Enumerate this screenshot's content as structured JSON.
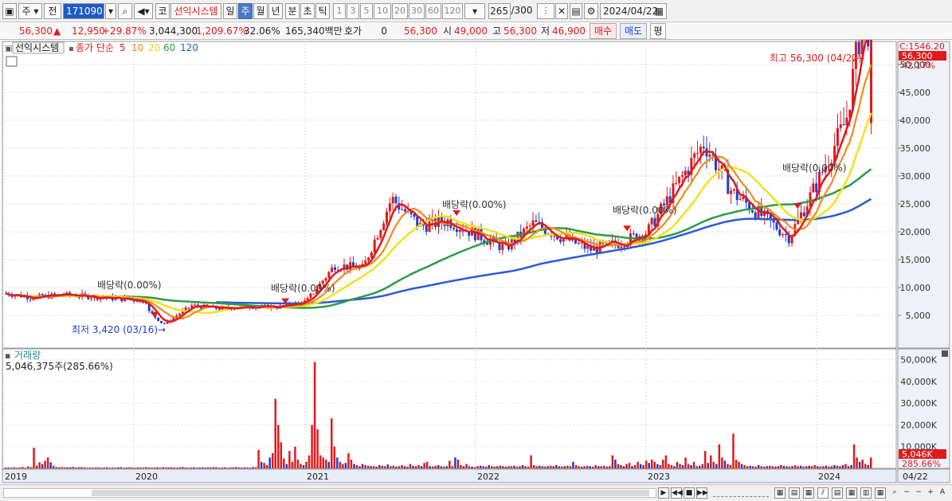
{
  "toolbar": {
    "market": "주",
    "kind": "전",
    "code": "171090",
    "name_prefix": "코",
    "name": "선익시스템",
    "periods": [
      "일",
      "주",
      "월",
      "년",
      "분",
      "초",
      "틱"
    ],
    "active_period": "주",
    "nums": [
      "1",
      "3",
      "5",
      "10",
      "20",
      "30",
      "60",
      "120"
    ],
    "count": "265",
    "count_total": "/300",
    "date": "2024/04/22"
  },
  "quote": {
    "price": "56,300",
    "change": "12,950",
    "change_pct": "+29.87%",
    "volume": "3,044,300",
    "vol_pct": "1,209.67%",
    "turnover": "32.06%",
    "amount": "165,340백만",
    "hoga_label": "호가",
    "hoga_val": "0",
    "ask": "56,300",
    "open_label": "시",
    "open": "49,000",
    "high_label": "고",
    "high": "56,300",
    "low_label": "저",
    "low": "46,900",
    "buy": "매수",
    "sell": "매도",
    "eval": "평"
  },
  "legend": {
    "name": "선익시스템",
    "ma_prefix": "종가 단순",
    "ma5": "5",
    "ma10": "10",
    "ma20": "20",
    "ma60": "60",
    "ma120": "120",
    "colors": {
      "ma5": "#e01a1a",
      "ma10": "#f08a1a",
      "ma20": "#f2e21a",
      "ma60": "#2e9a4a",
      "ma120": "#2a5ad6"
    }
  },
  "annotations": {
    "c_label": "C:1546.20",
    "last_price": "56,300",
    "last_pct": "42.17%",
    "high_note": "최고 56,300 (04/22)",
    "low_note": "최저 3,420 (03/16)",
    "dividend": "배당락(0.00%)"
  },
  "volume_pane": {
    "title": "거래량",
    "value": "5,046,375주(285.66%)",
    "last_tag": "5,046K",
    "last_pct": "285.66%"
  },
  "chart_data": {
    "type": "candlestick",
    "price_axis": [
      "50,000",
      "45,000",
      "40,000",
      "35,000",
      "30,000",
      "25,000",
      "20,000",
      "15,000",
      "10,000",
      "5,000"
    ],
    "price_ylim": [
      0,
      55000
    ],
    "volume_axis": [
      "50,000K",
      "40,000K",
      "30,000K",
      "20,000K",
      "10,000K"
    ],
    "x_labels": [
      "2019",
      "2020",
      "2021",
      "2022",
      "2023",
      "2024",
      "04/22"
    ],
    "close_series": [
      [
        "2019-01",
        9000
      ],
      [
        "2019-03",
        8200
      ],
      [
        "2019-05",
        8700
      ],
      [
        "2019-07",
        8400
      ],
      [
        "2019-09",
        8000
      ],
      [
        "2019-11",
        7600
      ],
      [
        "2020-01",
        7800
      ],
      [
        "2020-03",
        3420
      ],
      [
        "2020-05",
        6800
      ],
      [
        "2020-07",
        6200
      ],
      [
        "2020-09",
        6600
      ],
      [
        "2020-11",
        6500
      ],
      [
        "2021-01",
        7500
      ],
      [
        "2021-03",
        14000
      ],
      [
        "2021-05",
        13500
      ],
      [
        "2021-07",
        26000
      ],
      [
        "2021-09",
        21000
      ],
      [
        "2021-11",
        22000
      ],
      [
        "2022-01",
        19500
      ],
      [
        "2022-03",
        17000
      ],
      [
        "2022-05",
        21500
      ],
      [
        "2022-07",
        19000
      ],
      [
        "2022-09",
        16800
      ],
      [
        "2022-11",
        18000
      ],
      [
        "2023-01",
        20000
      ],
      [
        "2023-03",
        28000
      ],
      [
        "2023-05",
        36000
      ],
      [
        "2023-07",
        27000
      ],
      [
        "2023-09",
        23000
      ],
      [
        "2023-11",
        19000
      ],
      [
        "2024-01",
        29000
      ],
      [
        "2024-03",
        40000
      ],
      [
        "2024-04",
        56300
      ]
    ],
    "dividend_marks": [
      "2019-12",
      "2020-12",
      "2021-12",
      "2022-12",
      "2023-12"
    ]
  },
  "volume_bars": [
    0.4,
    0.4,
    0.3,
    0.5,
    0.3,
    0.4,
    0.6,
    0.3,
    0.9,
    0.5,
    9.5,
    1.2,
    2.8,
    2.0,
    3.5,
    5.0,
    2.8,
    1.2,
    0.6,
    0.5,
    0.6,
    0.4,
    0.5,
    0.5,
    0.7,
    0.4,
    0.5,
    0.6,
    0.4,
    0.3,
    0.4,
    0.3,
    0.4,
    0.5,
    0.3,
    0.4,
    0.5,
    0.3,
    0.4,
    0.3,
    0.5,
    0.6,
    0.3,
    0.4,
    0.5,
    0.4,
    0.3,
    0.5,
    0.4,
    0.3,
    0.6,
    0.4,
    0.3,
    0.4,
    0.5,
    0.3,
    0.6,
    0.5,
    0.4,
    0.5,
    0.4,
    0.3,
    0.5,
    0.6,
    0.4,
    0.3,
    0.4,
    0.5,
    0.3,
    0.4,
    0.5,
    0.4,
    0.5,
    0.4,
    0.6,
    0.5,
    0.3,
    0.4,
    0.5,
    0.3,
    0.4,
    0.5,
    0.6,
    0.4,
    0.3,
    0.5,
    0.4,
    0.3,
    0.6,
    0.5,
    8.5,
    3.0,
    2.5,
    1.5,
    5.0,
    7.0,
    32.0,
    20.0,
    12.0,
    4.5,
    2.0,
    8.0,
    3.0,
    10.0,
    4.0,
    2.0,
    1.5,
    3.0,
    6.0,
    20.0,
    49.0,
    18.0,
    6.0,
    5.0,
    4.0,
    3.0,
    23.0,
    10.0,
    5.0,
    3.0,
    2.0,
    2.5,
    7.0,
    4.0,
    2.0,
    1.5,
    1.0,
    2.0,
    1.5,
    1.2,
    1.0,
    1.0,
    0.8,
    1.5,
    1.2,
    1.0,
    1.8,
    1.0,
    1.2,
    0.8,
    1.0,
    1.5,
    1.0,
    0.8,
    2.0,
    1.2,
    1.0,
    1.5,
    1.0,
    2.5,
    3.0,
    1.0,
    0.8,
    1.2,
    1.5,
    1.0,
    0.8,
    1.0,
    3.5,
    1.0,
    5.0,
    4.0,
    1.5,
    1.0,
    2.0,
    1.0,
    0.8,
    0.6,
    1.0,
    1.2,
    1.0,
    0.8,
    1.5,
    1.0,
    0.8,
    1.0,
    1.2,
    1.0,
    0.8,
    1.0,
    1.0,
    1.2,
    0.8,
    1.0,
    1.5,
    1.0,
    0.8,
    6.0,
    1.5,
    1.0,
    1.2,
    1.0,
    0.8,
    1.0,
    1.2,
    1.0,
    1.5,
    1.0,
    0.8,
    1.0,
    1.2,
    1.0,
    3.0,
    1.5,
    1.0,
    0.8,
    1.0,
    1.2,
    1.0,
    0.8,
    1.5,
    1.0,
    1.0,
    1.2,
    0.8,
    1.0,
    6.0,
    4.0,
    2.0,
    1.5,
    1.0,
    2.0,
    2.5,
    1.0,
    1.5,
    3.0,
    2.0,
    1.5,
    3.5,
    2.5,
    4.0,
    3.0,
    2.0,
    1.5,
    4.0,
    6.0,
    2.0,
    1.5,
    1.0,
    3.0,
    2.0,
    1.5,
    5.0,
    2.0,
    1.5,
    3.0,
    1.0,
    1.2,
    2.0,
    8.0,
    2.5,
    6.0,
    3.0,
    2.0,
    11.0,
    5.0,
    3.5,
    2.0,
    1.5,
    16.0,
    4.0,
    3.0,
    2.0,
    1.5,
    1.0,
    1.2,
    1.0,
    0.8,
    1.5,
    1.0,
    0.8,
    1.0,
    1.2,
    1.0,
    0.8,
    1.0,
    1.5,
    1.2,
    1.0,
    0.8,
    1.0,
    1.5,
    1.0,
    1.2,
    0.8,
    1.0,
    1.2,
    1.0,
    1.5,
    1.0,
    0.8,
    1.0,
    1.2,
    0.8,
    1.0,
    1.5,
    1.2,
    1.0,
    1.5,
    2.0,
    1.0,
    1.5,
    11.0,
    5.0,
    3.0,
    4.0,
    2.0,
    1.5,
    5.0
  ]
}
